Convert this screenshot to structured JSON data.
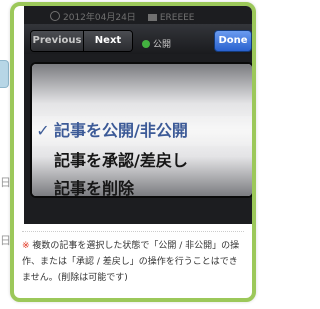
{
  "background": {
    "side_text_1": "日",
    "side_text_2": "日"
  },
  "behind_bar": {
    "date": "2012年04月24日",
    "category": "EREEEE"
  },
  "toolbar": {
    "previous_label": "Previous",
    "next_label": "Next",
    "status_label": "公開",
    "done_label": "Done"
  },
  "picker": {
    "check_mark": "✓",
    "items": [
      {
        "label": "記事を公開/非公開",
        "selected": true
      },
      {
        "label": "記事を承認/差戻し",
        "selected": false
      },
      {
        "label": "記事を削除",
        "selected": false
      }
    ]
  },
  "note": {
    "mark": "※",
    "text": "複数の記事を選択した状態で「公開 / 非公開」の操作、または「承認 / 差戻し」の操作を行うことはできません。(削除は可能です)"
  },
  "colors": {
    "frame": "#9cc85a",
    "done_button": "#2a62cf",
    "selected_text": "#3c5a97",
    "note_mark": "#e0311c"
  }
}
